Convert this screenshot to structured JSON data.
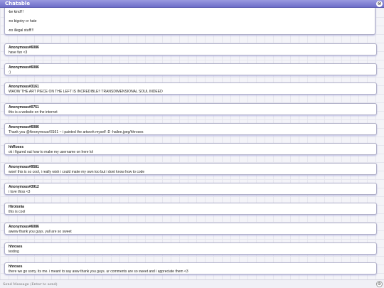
{
  "window": {
    "title": "Chatable",
    "close_icon": "⊗"
  },
  "rules": [
    "-be kind!!!",
    "-no bigotry or hate",
    "-no illegal stuff!!!"
  ],
  "messages": [
    {
      "author": "Anonymous#6086",
      "text": "have fun <3"
    },
    {
      "author": "Anonymous#6086",
      "text": ":)"
    },
    {
      "author": "Anonymous#3161",
      "text": "WAOW THE ART PIECE ON THE LEFT IS INCREDIBLE!! TRANSDIMENSIONAL SOUL INDEED"
    },
    {
      "author": "Anonymous#0751",
      "text": "this is a website on the internet"
    },
    {
      "author": "Anonymous#6086",
      "text": "Thank you @Anonymous#3161 ~ i painted the artwork myself :D -hailee.jpeg/hhroses"
    },
    {
      "author": "hhRoses",
      "text": "ok i figured out how to make my username on here lol"
    },
    {
      "author": "Anonymous#9581",
      "text": "wow! this is so cool, i really wish i could make my own too but i dont know how to code"
    },
    {
      "author": "Anonymous#3912",
      "text": "i love thiss <3"
    },
    {
      "author": "Hirotonia",
      "text": "this is cool"
    },
    {
      "author": "Anonymous#6086",
      "text": "awww thank you guys. yall are so sweet"
    },
    {
      "author": "hhroses",
      "text": "testing"
    },
    {
      "author": "hhroses",
      "text": "there we go sorry. its me. i meant to say aww thank you guys. ur comments are so sweet and i appreciate them <3"
    }
  ],
  "composer": {
    "placeholder": "Send Message (Enter to send)",
    "settings_icon": "⚙"
  }
}
